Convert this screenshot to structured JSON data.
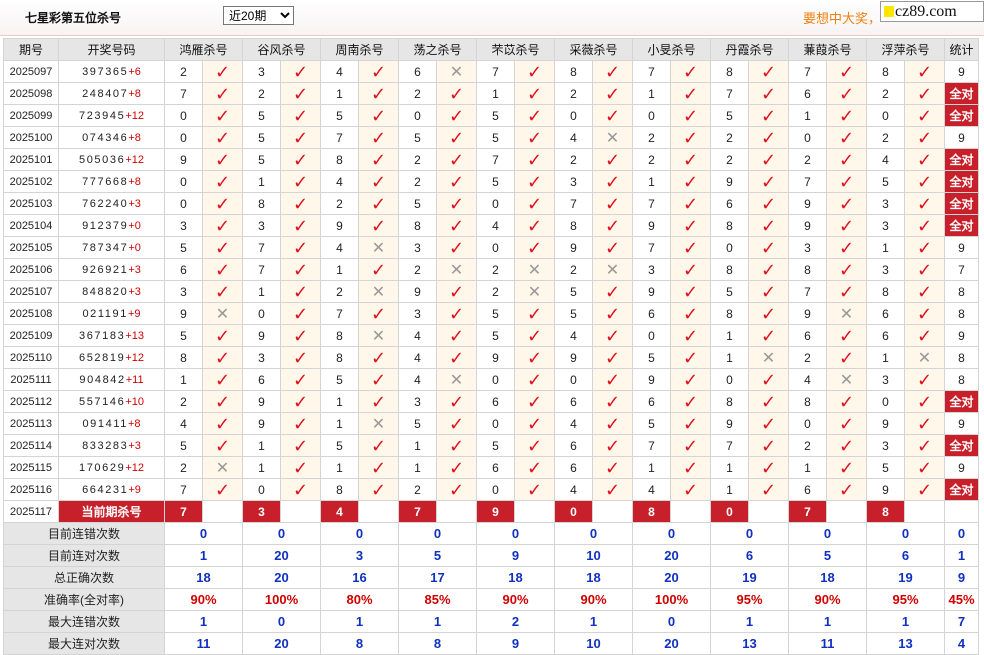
{
  "header": {
    "title": "七星彩第五位杀号",
    "range_select": "近20期",
    "promo": "要想中大奖，",
    "logo_text": "cz89.com"
  },
  "columns": {
    "issue": "期号",
    "draw": "开奖号码",
    "experts": [
      "鸿雁杀号",
      "谷风杀号",
      "周南杀号",
      "荡之杀号",
      "芣苡杀号",
      "采薇杀号",
      "小旻杀号",
      "丹霞杀号",
      "蒹葭杀号",
      "浮萍杀号"
    ],
    "stat": "统计"
  },
  "rows": [
    {
      "issue": "2025097",
      "draw": "397365",
      "sum": "+6",
      "kills": [
        [
          2,
          1
        ],
        [
          3,
          1
        ],
        [
          4,
          1
        ],
        [
          6,
          0
        ],
        [
          7,
          1
        ],
        [
          8,
          1
        ],
        [
          7,
          1
        ],
        [
          8,
          1
        ],
        [
          7,
          1
        ],
        [
          8,
          1
        ]
      ],
      "stat": "9"
    },
    {
      "issue": "2025098",
      "draw": "248407",
      "sum": "+8",
      "kills": [
        [
          7,
          1
        ],
        [
          2,
          1
        ],
        [
          1,
          1
        ],
        [
          2,
          1
        ],
        [
          1,
          1
        ],
        [
          2,
          1
        ],
        [
          1,
          1
        ],
        [
          7,
          1
        ],
        [
          6,
          1
        ],
        [
          2,
          1
        ]
      ],
      "stat": "全对"
    },
    {
      "issue": "2025099",
      "draw": "723945",
      "sum": "+12",
      "kills": [
        [
          0,
          1
        ],
        [
          5,
          1
        ],
        [
          5,
          1
        ],
        [
          0,
          1
        ],
        [
          5,
          1
        ],
        [
          0,
          1
        ],
        [
          0,
          1
        ],
        [
          5,
          1
        ],
        [
          1,
          1
        ],
        [
          0,
          1
        ]
      ],
      "stat": "全对"
    },
    {
      "issue": "2025100",
      "draw": "074346",
      "sum": "+8",
      "kills": [
        [
          0,
          1
        ],
        [
          5,
          1
        ],
        [
          7,
          1
        ],
        [
          5,
          1
        ],
        [
          5,
          1
        ],
        [
          4,
          0
        ],
        [
          2,
          1
        ],
        [
          2,
          1
        ],
        [
          0,
          1
        ],
        [
          2,
          1
        ]
      ],
      "stat": "9"
    },
    {
      "issue": "2025101",
      "draw": "505036",
      "sum": "+12",
      "kills": [
        [
          9,
          1
        ],
        [
          5,
          1
        ],
        [
          8,
          1
        ],
        [
          2,
          1
        ],
        [
          7,
          1
        ],
        [
          2,
          1
        ],
        [
          2,
          1
        ],
        [
          2,
          1
        ],
        [
          2,
          1
        ],
        [
          4,
          1
        ]
      ],
      "stat": "全对"
    },
    {
      "issue": "2025102",
      "draw": "777668",
      "sum": "+8",
      "kills": [
        [
          0,
          1
        ],
        [
          1,
          1
        ],
        [
          4,
          1
        ],
        [
          2,
          1
        ],
        [
          5,
          1
        ],
        [
          3,
          1
        ],
        [
          1,
          1
        ],
        [
          9,
          1
        ],
        [
          7,
          1
        ],
        [
          5,
          1
        ]
      ],
      "stat": "全对"
    },
    {
      "issue": "2025103",
      "draw": "762240",
      "sum": "+3",
      "kills": [
        [
          0,
          1
        ],
        [
          8,
          1
        ],
        [
          2,
          1
        ],
        [
          5,
          1
        ],
        [
          0,
          1
        ],
        [
          7,
          1
        ],
        [
          7,
          1
        ],
        [
          6,
          1
        ],
        [
          9,
          1
        ],
        [
          3,
          1
        ]
      ],
      "stat": "全对"
    },
    {
      "issue": "2025104",
      "draw": "912379",
      "sum": "+0",
      "kills": [
        [
          3,
          1
        ],
        [
          3,
          1
        ],
        [
          9,
          1
        ],
        [
          8,
          1
        ],
        [
          4,
          1
        ],
        [
          8,
          1
        ],
        [
          9,
          1
        ],
        [
          8,
          1
        ],
        [
          9,
          1
        ],
        [
          3,
          1
        ]
      ],
      "stat": "全对"
    },
    {
      "issue": "2025105",
      "draw": "787347",
      "sum": "+0",
      "kills": [
        [
          5,
          1
        ],
        [
          7,
          1
        ],
        [
          4,
          0
        ],
        [
          3,
          1
        ],
        [
          0,
          1
        ],
        [
          9,
          1
        ],
        [
          7,
          1
        ],
        [
          0,
          1
        ],
        [
          3,
          1
        ],
        [
          1,
          1
        ]
      ],
      "stat": "9"
    },
    {
      "issue": "2025106",
      "draw": "926921",
      "sum": "+3",
      "kills": [
        [
          6,
          1
        ],
        [
          7,
          1
        ],
        [
          1,
          1
        ],
        [
          2,
          0
        ],
        [
          2,
          0
        ],
        [
          2,
          0
        ],
        [
          3,
          1
        ],
        [
          8,
          1
        ],
        [
          8,
          1
        ],
        [
          3,
          1
        ]
      ],
      "stat": "7"
    },
    {
      "issue": "2025107",
      "draw": "848820",
      "sum": "+3",
      "kills": [
        [
          3,
          1
        ],
        [
          1,
          1
        ],
        [
          2,
          0
        ],
        [
          9,
          1
        ],
        [
          2,
          0
        ],
        [
          5,
          1
        ],
        [
          9,
          1
        ],
        [
          5,
          1
        ],
        [
          7,
          1
        ],
        [
          8,
          1
        ]
      ],
      "stat": "8"
    },
    {
      "issue": "2025108",
      "draw": "021191",
      "sum": "+9",
      "kills": [
        [
          9,
          0
        ],
        [
          0,
          1
        ],
        [
          7,
          1
        ],
        [
          3,
          1
        ],
        [
          5,
          1
        ],
        [
          5,
          1
        ],
        [
          6,
          1
        ],
        [
          8,
          1
        ],
        [
          9,
          0
        ],
        [
          6,
          1
        ]
      ],
      "stat": "8"
    },
    {
      "issue": "2025109",
      "draw": "367183",
      "sum": "+13",
      "kills": [
        [
          5,
          1
        ],
        [
          9,
          1
        ],
        [
          8,
          0
        ],
        [
          4,
          1
        ],
        [
          5,
          1
        ],
        [
          4,
          1
        ],
        [
          0,
          1
        ],
        [
          1,
          1
        ],
        [
          6,
          1
        ],
        [
          6,
          1
        ]
      ],
      "stat": "9"
    },
    {
      "issue": "2025110",
      "draw": "652819",
      "sum": "+12",
      "kills": [
        [
          8,
          1
        ],
        [
          3,
          1
        ],
        [
          8,
          1
        ],
        [
          4,
          1
        ],
        [
          9,
          1
        ],
        [
          9,
          1
        ],
        [
          5,
          1
        ],
        [
          1,
          0
        ],
        [
          2,
          1
        ],
        [
          1,
          0
        ]
      ],
      "stat": "8"
    },
    {
      "issue": "2025111",
      "draw": "904842",
      "sum": "+11",
      "kills": [
        [
          1,
          1
        ],
        [
          6,
          1
        ],
        [
          5,
          1
        ],
        [
          4,
          0
        ],
        [
          0,
          1
        ],
        [
          0,
          1
        ],
        [
          9,
          1
        ],
        [
          0,
          1
        ],
        [
          4,
          0
        ],
        [
          3,
          1
        ]
      ],
      "stat": "8"
    },
    {
      "issue": "2025112",
      "draw": "557146",
      "sum": "+10",
      "kills": [
        [
          2,
          1
        ],
        [
          9,
          1
        ],
        [
          1,
          1
        ],
        [
          3,
          1
        ],
        [
          6,
          1
        ],
        [
          6,
          1
        ],
        [
          6,
          1
        ],
        [
          8,
          1
        ],
        [
          8,
          1
        ],
        [
          0,
          1
        ]
      ],
      "stat": "全对"
    },
    {
      "issue": "2025113",
      "draw": "091411",
      "sum": "+8",
      "kills": [
        [
          4,
          1
        ],
        [
          9,
          1
        ],
        [
          1,
          0
        ],
        [
          5,
          1
        ],
        [
          0,
          1
        ],
        [
          4,
          1
        ],
        [
          5,
          1
        ],
        [
          9,
          1
        ],
        [
          0,
          1
        ],
        [
          9,
          1
        ]
      ],
      "stat": "9"
    },
    {
      "issue": "2025114",
      "draw": "833283",
      "sum": "+3",
      "kills": [
        [
          5,
          1
        ],
        [
          1,
          1
        ],
        [
          5,
          1
        ],
        [
          1,
          1
        ],
        [
          5,
          1
        ],
        [
          6,
          1
        ],
        [
          7,
          1
        ],
        [
          7,
          1
        ],
        [
          2,
          1
        ],
        [
          3,
          1
        ]
      ],
      "stat": "全对"
    },
    {
      "issue": "2025115",
      "draw": "170629",
      "sum": "+12",
      "kills": [
        [
          2,
          0
        ],
        [
          1,
          1
        ],
        [
          1,
          1
        ],
        [
          1,
          1
        ],
        [
          6,
          1
        ],
        [
          6,
          1
        ],
        [
          1,
          1
        ],
        [
          1,
          1
        ],
        [
          1,
          1
        ],
        [
          5,
          1
        ]
      ],
      "stat": "9"
    },
    {
      "issue": "2025116",
      "draw": "664231",
      "sum": "+9",
      "kills": [
        [
          7,
          1
        ],
        [
          0,
          1
        ],
        [
          8,
          1
        ],
        [
          2,
          1
        ],
        [
          0,
          1
        ],
        [
          4,
          1
        ],
        [
          4,
          1
        ],
        [
          1,
          1
        ],
        [
          6,
          1
        ],
        [
          9,
          1
        ]
      ],
      "stat": "全对"
    }
  ],
  "current": {
    "issue": "2025117",
    "label": "当前期杀号",
    "picks": [
      "7",
      "3",
      "4",
      "7",
      "9",
      "0",
      "8",
      "0",
      "7",
      "8"
    ]
  },
  "summary": [
    {
      "label": "目前连错次数",
      "values": [
        "0",
        "0",
        "0",
        "0",
        "0",
        "0",
        "0",
        "0",
        "0",
        "0"
      ],
      "stat": "0",
      "red": false
    },
    {
      "label": "目前连对次数",
      "values": [
        "1",
        "20",
        "3",
        "5",
        "9",
        "10",
        "20",
        "6",
        "5",
        "6"
      ],
      "stat": "1",
      "red": false
    },
    {
      "label": "总正确次数",
      "values": [
        "18",
        "20",
        "16",
        "17",
        "18",
        "18",
        "20",
        "19",
        "18",
        "19"
      ],
      "stat": "9",
      "red": false
    },
    {
      "label": "准确率(全对率)",
      "values": [
        "90%",
        "100%",
        "80%",
        "85%",
        "90%",
        "90%",
        "100%",
        "95%",
        "90%",
        "95%"
      ],
      "stat": "45%",
      "red": true
    },
    {
      "label": "最大连错次数",
      "values": [
        "1",
        "0",
        "1",
        "1",
        "2",
        "1",
        "0",
        "1",
        "1",
        "1"
      ],
      "stat": "7",
      "red": false
    },
    {
      "label": "最大连对次数",
      "values": [
        "11",
        "20",
        "8",
        "8",
        "9",
        "10",
        "20",
        "13",
        "11",
        "13"
      ],
      "stat": "4",
      "red": false
    }
  ],
  "icons": {
    "correct": "check-icon",
    "wrong": "cross-icon"
  },
  "colors": {
    "accent_red": "#c8202a",
    "check_red": "#e0101e",
    "stat_blue": "#1030c0",
    "promo_orange": "#f08010"
  }
}
